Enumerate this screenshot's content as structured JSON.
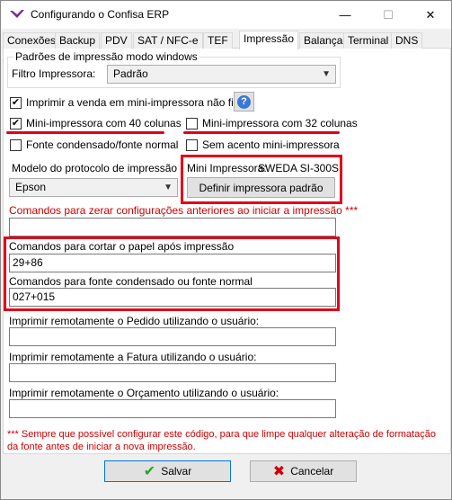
{
  "window": {
    "title": "Configurando o Confisa ERP",
    "min_glyph": "—",
    "max_glyph": "☐",
    "close_glyph": "✕"
  },
  "tabs": [
    {
      "label": "Conexões"
    },
    {
      "label": "Backup"
    },
    {
      "label": "PDV"
    },
    {
      "label": "SAT / NFC-e"
    },
    {
      "label": "TEF"
    },
    {
      "label": "Impressão",
      "active": true
    },
    {
      "label": "Balança"
    },
    {
      "label": "Terminal"
    },
    {
      "label": "DNS"
    }
  ],
  "group": {
    "legend": "Padrões de impressão modo windows",
    "filter_label": "Filtro Impressora:",
    "filter_value": "Padrão"
  },
  "checks": {
    "print_sale": {
      "label": "Imprimir a venda em mini-impressora não fiscal",
      "checked": true
    },
    "cols40": {
      "label": "Mini-impressora com 40 colunas",
      "checked": true
    },
    "cols32": {
      "label": "Mini-impressora com 32 colunas",
      "checked": false
    },
    "condensed": {
      "label": "Fonte condensado/fonte normal",
      "checked": false
    },
    "no_accent": {
      "label": "Sem acento mini-impressora",
      "checked": false
    }
  },
  "protocol": {
    "label": "Modelo do protocolo de impressão",
    "value": "Epson"
  },
  "printer": {
    "label": "Mini Impressora:",
    "name": "SWEDA SI-300S",
    "set_default_button": "Definir impressora padrão"
  },
  "reset_commands": {
    "label": "Comandos para zerar configurações anteriores ao iniciar a impressão ***",
    "value": ""
  },
  "cut_commands": {
    "label": "Comandos para cortar o papel após impressão",
    "value": "29+86"
  },
  "font_commands": {
    "label": "Comandos para fonte condensado ou fonte normal",
    "value": "027+015"
  },
  "remote": {
    "order_label": "Imprimir remotamente o Pedido utilizando o usuário:",
    "order_value": "",
    "invoice_label": "Imprimir remotamente a Fatura utilizando o usuário:",
    "invoice_value": "",
    "quote_label": "Imprimir remotamente o Orçamento utilizando o usuário:",
    "quote_value": ""
  },
  "footnote": "*** Sempre que possível configurar este código, para que limpe qualquer alteração de formatação da fonte antes de iniciar a nova impressão.",
  "buttons": {
    "save": "Salvar",
    "cancel": "Cancelar"
  },
  "colors": {
    "highlight": "#e0001b",
    "warning_text": "#cc0000",
    "save_icon": "#2e9e2e",
    "cancel_icon": "#d00000"
  }
}
